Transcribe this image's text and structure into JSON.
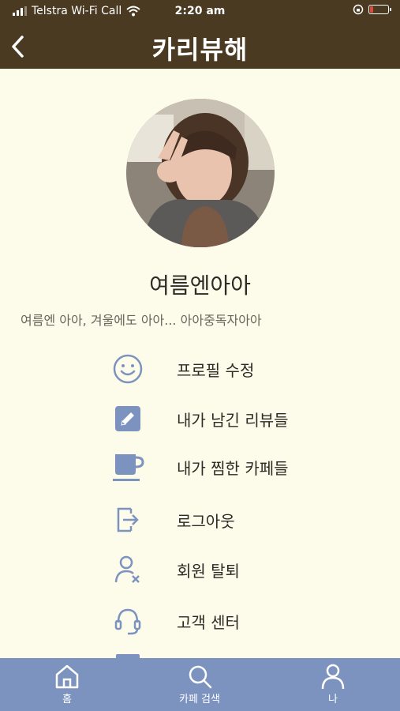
{
  "status": {
    "carrier": "Telstra Wi-Fi Call",
    "time": "2:20 am",
    "battery_level": 0.2
  },
  "header": {
    "title": "카리뷰해"
  },
  "profile": {
    "nickname": "여름엔아아",
    "bio": "여름엔 아아, 겨울에도 아아... 아아중독자아아"
  },
  "menu": [
    {
      "label": "프로필 수정",
      "icon": "smiley-icon"
    },
    {
      "label": "내가 남긴 리뷰들",
      "icon": "edit-pencil-icon"
    },
    {
      "label": "내가 찜한 카페들",
      "icon": "coffee-cup-icon"
    },
    {
      "label": "로그아웃",
      "icon": "logout-icon"
    },
    {
      "label": "회원 탈퇴",
      "icon": "user-remove-icon"
    },
    {
      "label": "고객 센터",
      "icon": "headset-icon"
    }
  ],
  "tabbar": [
    {
      "label": "홈",
      "icon": "home-icon"
    },
    {
      "label": "카페 검색",
      "icon": "search-icon"
    },
    {
      "label": "나",
      "icon": "user-icon"
    }
  ],
  "colors": {
    "header": "#4b3a22",
    "background": "#fdfbe9",
    "accent": "#7c93c0",
    "tabbar": "#7c93c0"
  }
}
